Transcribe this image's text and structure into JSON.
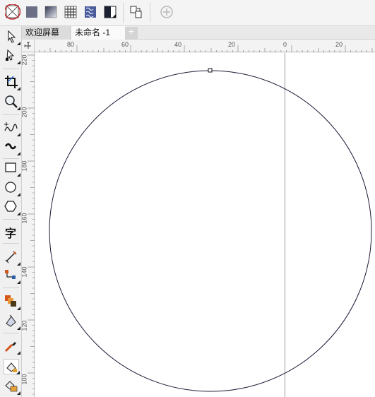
{
  "property_bar": {
    "buttons": [
      {
        "name": "no-fill-button",
        "icon": "no-fill-icon",
        "selected": true
      },
      {
        "name": "uniform-fill-button",
        "icon": "uniform-fill-icon"
      },
      {
        "name": "fountain-fill-button",
        "icon": "fountain-fill-icon"
      },
      {
        "name": "pattern-fill-button",
        "icon": "pattern-fill-icon"
      },
      {
        "name": "texture-fill-button",
        "icon": "texture-fill-icon"
      },
      {
        "name": "postscript-fill-button",
        "icon": "postscript-fill-icon"
      },
      {
        "name": "copy-fill-button",
        "icon": "copy-fill-icon"
      },
      {
        "name": "add-button",
        "icon": "plus-circle-icon"
      }
    ],
    "selection_color": "#c0282d"
  },
  "tabs": {
    "welcome_label": "欢迎屏幕",
    "document_label": "未命名 -1",
    "add_label": "+"
  },
  "toolbox": {
    "tools": [
      "pick-tool",
      "shape-tool",
      "crop-tool",
      "zoom-tool",
      "freehand-tool",
      "artistic-media-tool",
      "rectangle-tool",
      "ellipse-tool",
      "polygon-tool",
      "text-tool",
      "parallel-dimension-tool",
      "connector-tool",
      "blend-tool",
      "transparency-tool",
      "eyedropper-tool",
      "interactive-fill-tool",
      "smart-fill-tool"
    ],
    "text_tool_glyph": "字"
  },
  "ruler": {
    "horizontal_labels": [
      "80",
      "60",
      "40",
      "20",
      "0",
      "20"
    ],
    "vertical_labels": [
      "220",
      "200",
      "180",
      "160",
      "140",
      "120",
      "100"
    ]
  },
  "canvas": {
    "circle_stroke": "#1d1836",
    "page_edge_color": "#9a9a9a"
  }
}
